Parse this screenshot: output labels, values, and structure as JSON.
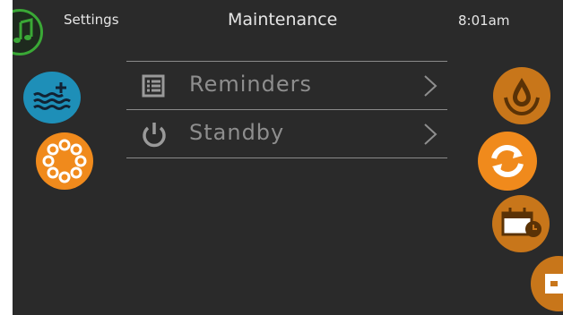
{
  "header": {
    "settings_label": "Settings",
    "title": "Maintenance",
    "time": "8:01am"
  },
  "menu": {
    "items": [
      {
        "label": "Reminders",
        "icon": "list-icon"
      },
      {
        "label": "Standby",
        "icon": "power-icon"
      }
    ]
  },
  "shortcuts": {
    "left": [
      "music-icon",
      "water-level-icon",
      "lights-icon"
    ],
    "right": [
      "filter-icon",
      "cycle-icon",
      "calendar-icon",
      "extension-icon"
    ]
  },
  "colors": {
    "background": "#2a2a2a",
    "text": "#e6e6e6",
    "menu_text": "#8e8e8e",
    "orange": "#f08a1c",
    "dark_orange": "#c8761a",
    "blue": "#1e8fb8",
    "green": "#3aa836"
  }
}
